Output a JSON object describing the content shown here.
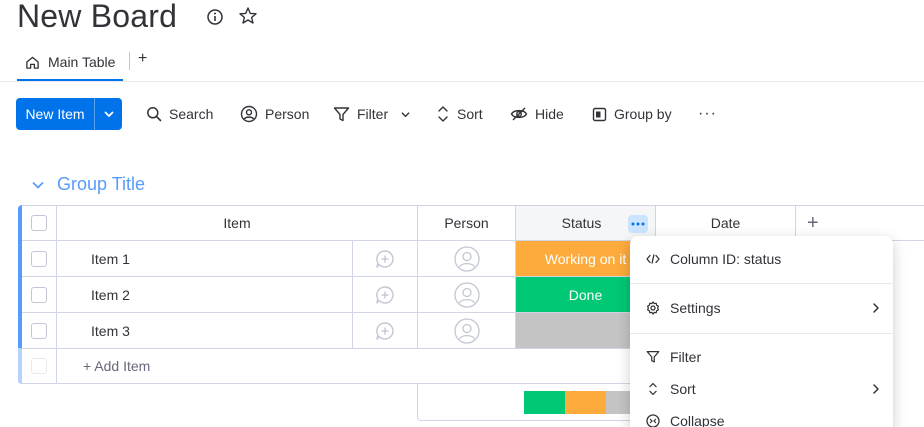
{
  "board": {
    "title": "New Board",
    "tabs": [
      {
        "label": "Main Table"
      }
    ],
    "add_tab": "+"
  },
  "toolbar": {
    "new_item": "New Item",
    "search": "Search",
    "person": "Person",
    "filter": "Filter",
    "sort": "Sort",
    "hide": "Hide",
    "group_by": "Group by",
    "more": "···"
  },
  "group": {
    "title": "Group Title",
    "color": "#579bfc",
    "columns": {
      "item": "Item",
      "person": "Person",
      "status": "Status",
      "date": "Date",
      "add": "+"
    },
    "rows": [
      {
        "item": "Item 1",
        "status": "Working on it",
        "status_color": "#fdab3d"
      },
      {
        "item": "Item 2",
        "status": "Done",
        "status_color": "#00c875"
      },
      {
        "item": "Item 3",
        "status": "",
        "status_color": "#c4c4c4"
      }
    ],
    "add_item": "+ Add Item",
    "status_summary": [
      {
        "color": "#00c875",
        "share": 0.333
      },
      {
        "color": "#fdab3d",
        "share": 0.333
      },
      {
        "color": "#c4c4c4",
        "share": 0.333
      }
    ]
  },
  "column_menu": {
    "items": [
      {
        "label": "Column ID: status",
        "icon": "code-icon"
      },
      {
        "label": "Settings",
        "icon": "gear-icon",
        "submenu": true
      },
      {
        "label": "Filter",
        "icon": "filter-icon"
      },
      {
        "label": "Sort",
        "icon": "sort-icon",
        "submenu": true
      },
      {
        "label": "Collapse",
        "icon": "collapse-icon"
      }
    ]
  },
  "colors": {
    "primary": "#0073ea",
    "done": "#00c875",
    "working": "#fdab3d",
    "empty": "#c4c4c4"
  }
}
